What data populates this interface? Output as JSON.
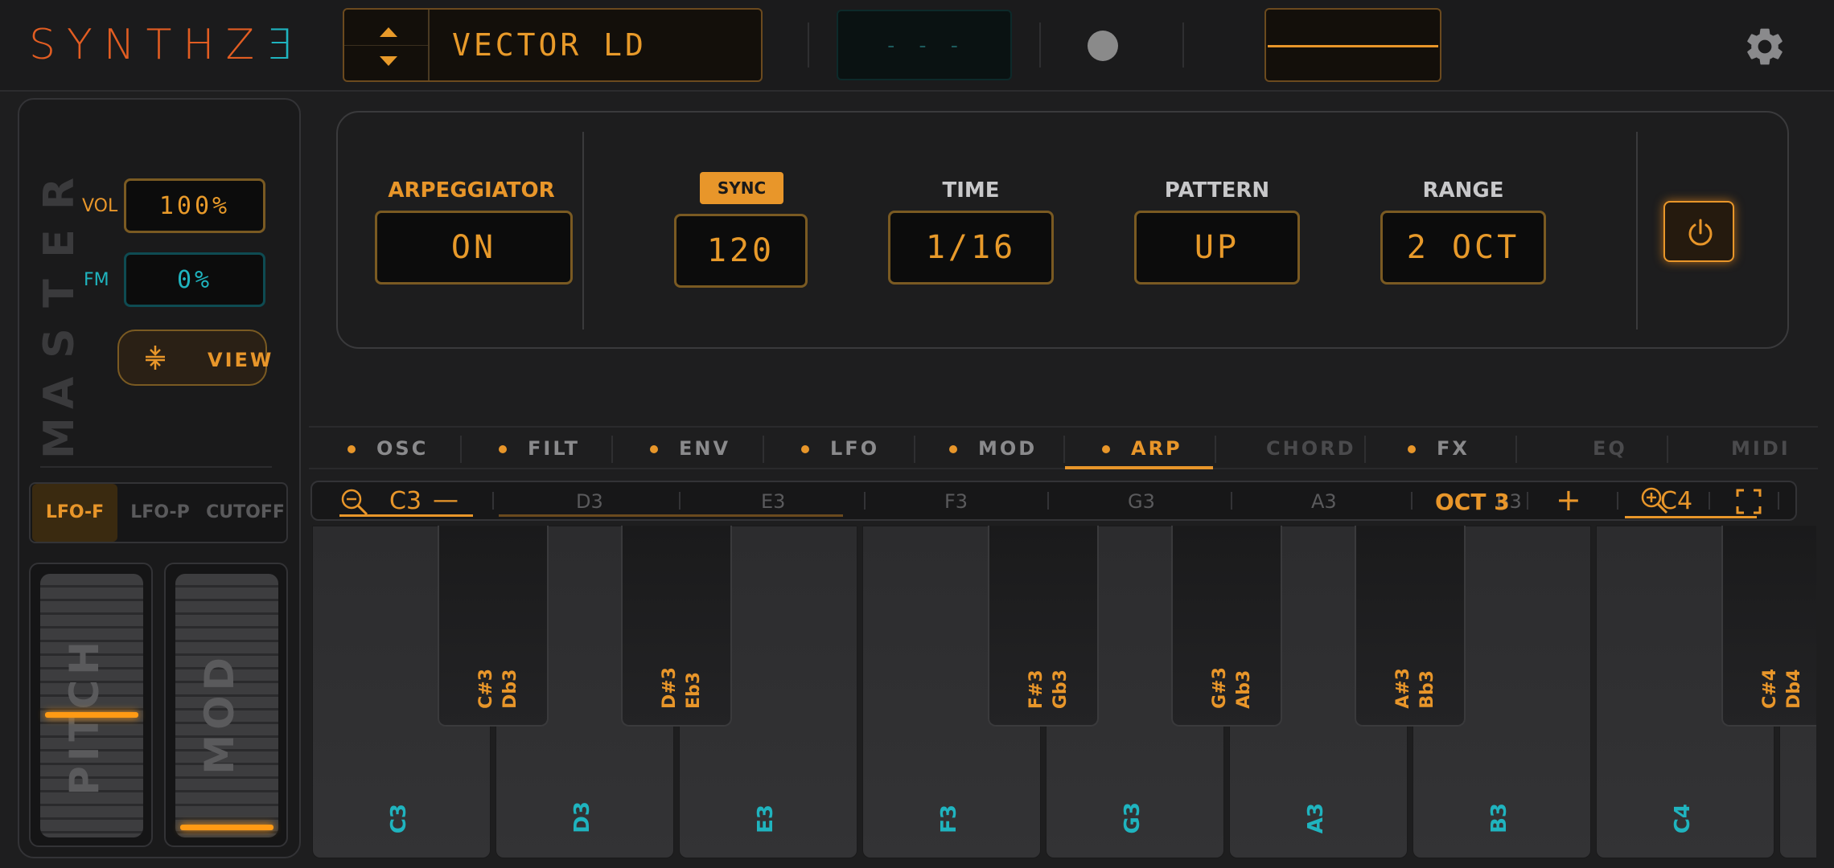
{
  "topbar": {
    "logo_main": "SYNTHZ",
    "logo_last": "Ǝ",
    "preset_name": "VECTOR LD",
    "status_display": "- - -",
    "up_icon": "chevron-up-icon",
    "down_icon": "chevron-down-icon",
    "settings_icon": "gear-icon"
  },
  "master": {
    "title": "MASTER",
    "vol_label": "VOL",
    "vol_value": "100%",
    "fm_label": "FM",
    "fm_value": "0%",
    "view_label": "VIEW",
    "lfo_tabs": [
      "LFO-F",
      "LFO-P",
      "CUTOFF"
    ],
    "lfo_active": "LFO-F",
    "pitch_label": "PITCH",
    "mod_label": "MOD"
  },
  "arp": {
    "arpeggiator_label": "ARPEGGIATOR",
    "arpeggiator_value": "ON",
    "sync_label": "SYNC",
    "bpm_value": "120",
    "time_label": "TIME",
    "time_value": "1/16",
    "pattern_label": "PATTERN",
    "pattern_value": "UP",
    "range_label": "RANGE",
    "range_value": "2 OCT",
    "power_icon": "power-icon"
  },
  "tabs": [
    {
      "label": "OSC",
      "dot": true
    },
    {
      "label": "FILT",
      "dot": true
    },
    {
      "label": "ENV",
      "dot": true
    },
    {
      "label": "LFO",
      "dot": true
    },
    {
      "label": "MOD",
      "dot": true
    },
    {
      "label": "ARP",
      "dot": true,
      "active": true
    },
    {
      "label": "CHORD",
      "dot": false
    },
    {
      "label": "FX",
      "dot": true
    },
    {
      "label": "EQ",
      "dot": false
    },
    {
      "label": "MIDI",
      "dot": false
    }
  ],
  "kbnav": {
    "left_note": "C3",
    "notes": [
      "D3",
      "E3",
      "F3",
      "G3",
      "A3",
      "B3"
    ],
    "octave": "OCT 3",
    "right_note": "C4",
    "minus": "—",
    "plus": "+"
  },
  "keyboard": {
    "white_keys": [
      "C3",
      "D3",
      "E3",
      "F3",
      "G3",
      "A3",
      "B3",
      "C4"
    ],
    "black_keys": [
      "C#3\nDb3",
      "D#3\nEb3",
      "F#3\nGb3",
      "G#3\nAb3",
      "A#3\nBb3",
      "C#4\nDb4"
    ]
  },
  "colors": {
    "accent": "#e8962a",
    "cyan": "#1fb4bf",
    "logo": "#e25d22"
  }
}
